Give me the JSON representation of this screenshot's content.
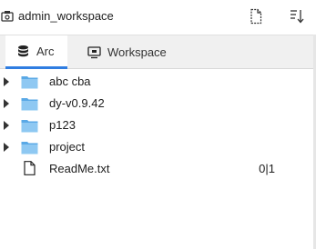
{
  "titlebar": {
    "title": "admin_workspace",
    "new_file_icon": "new-file-icon",
    "sort_icon": "sort-icon"
  },
  "tabs": [
    {
      "label": "Arc",
      "icon": "database-icon",
      "active": true
    },
    {
      "label": "Workspace",
      "icon": "monitor-icon",
      "active": false
    }
  ],
  "tree": [
    {
      "type": "folder",
      "label": "abc cba"
    },
    {
      "type": "folder",
      "label": "dy-v0.9.42"
    },
    {
      "type": "folder",
      "label": "p123"
    },
    {
      "type": "folder",
      "label": "project"
    },
    {
      "type": "file",
      "label": "ReadMe.txt",
      "meta": "0|1"
    }
  ],
  "colors": {
    "accent": "#2f7de1",
    "folder": "#5aa9e6"
  }
}
